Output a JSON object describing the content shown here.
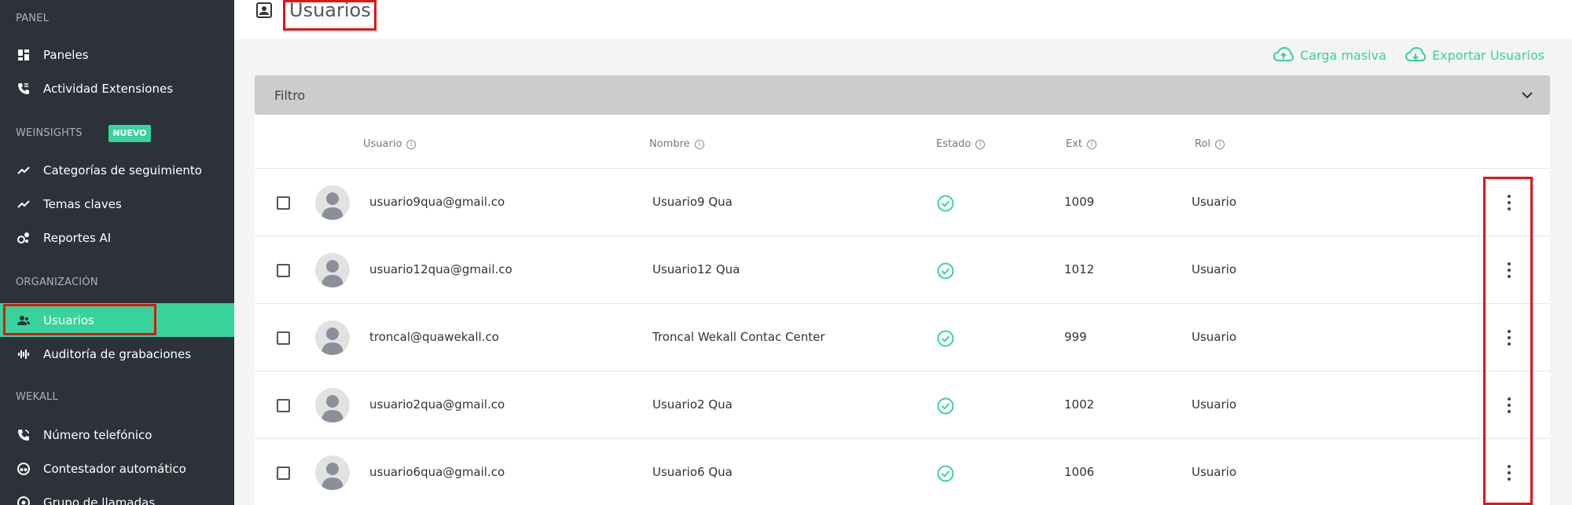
{
  "sidebar": {
    "sections": [
      {
        "title": "PANEL"
      },
      {
        "title": "WEINSIGHTS",
        "badge": "NUEVO"
      },
      {
        "title": "ORGANIZACIÓN"
      },
      {
        "title": "WEKALL"
      }
    ],
    "items": [
      {
        "label": "Paneles",
        "icon": "dashboard-icon"
      },
      {
        "label": "Actividad Extensiones",
        "icon": "phone-activity-icon"
      },
      {
        "label": "Categorías de seguimiento",
        "icon": "trend-icon"
      },
      {
        "label": "Temas claves",
        "icon": "trend-icon"
      },
      {
        "label": "Reportes AI",
        "icon": "ai-report-icon"
      },
      {
        "label": "Usuarios",
        "icon": "users-icon",
        "active": true
      },
      {
        "label": "Auditoría de grabaciones",
        "icon": "audio-wave-icon"
      },
      {
        "label": "Número telefónico",
        "icon": "phone-icon"
      },
      {
        "label": "Contestador automático",
        "icon": "autoresponder-icon"
      },
      {
        "label": "Grupo de llamadas",
        "icon": "call-group-icon"
      }
    ]
  },
  "header": {
    "title": "Usuarios",
    "icon": "user-card-icon"
  },
  "actions": {
    "bulk_upload": "Carga masiva",
    "export_users": "Exportar Usuarios"
  },
  "filter": {
    "label": "Filtro"
  },
  "table": {
    "columns": [
      "Usuario",
      "Nombre",
      "Estado",
      "Ext",
      "Rol"
    ],
    "rows": [
      {
        "usuario": "usuario9qua@gmail.co",
        "nombre": "Usuario9 Qua",
        "estado": "active",
        "ext": "1009",
        "rol": "Usuario"
      },
      {
        "usuario": "usuario12qua@gmail.co",
        "nombre": "Usuario12 Qua",
        "estado": "active",
        "ext": "1012",
        "rol": "Usuario"
      },
      {
        "usuario": "troncal@quawekall.co",
        "nombre": "Troncal Wekall Contac Center",
        "estado": "active",
        "ext": "999",
        "rol": "Usuario"
      },
      {
        "usuario": "usuario2qua@gmail.co",
        "nombre": "Usuario2 Qua",
        "estado": "active",
        "ext": "1002",
        "rol": "Usuario"
      },
      {
        "usuario": "usuario6qua@gmail.co",
        "nombre": "Usuario6 Qua",
        "estado": "active",
        "ext": "1006",
        "rol": "Usuario"
      }
    ]
  },
  "colors": {
    "accent": "#37d39a",
    "sidebar_bg": "#2d3139",
    "highlight": "#e01515"
  }
}
